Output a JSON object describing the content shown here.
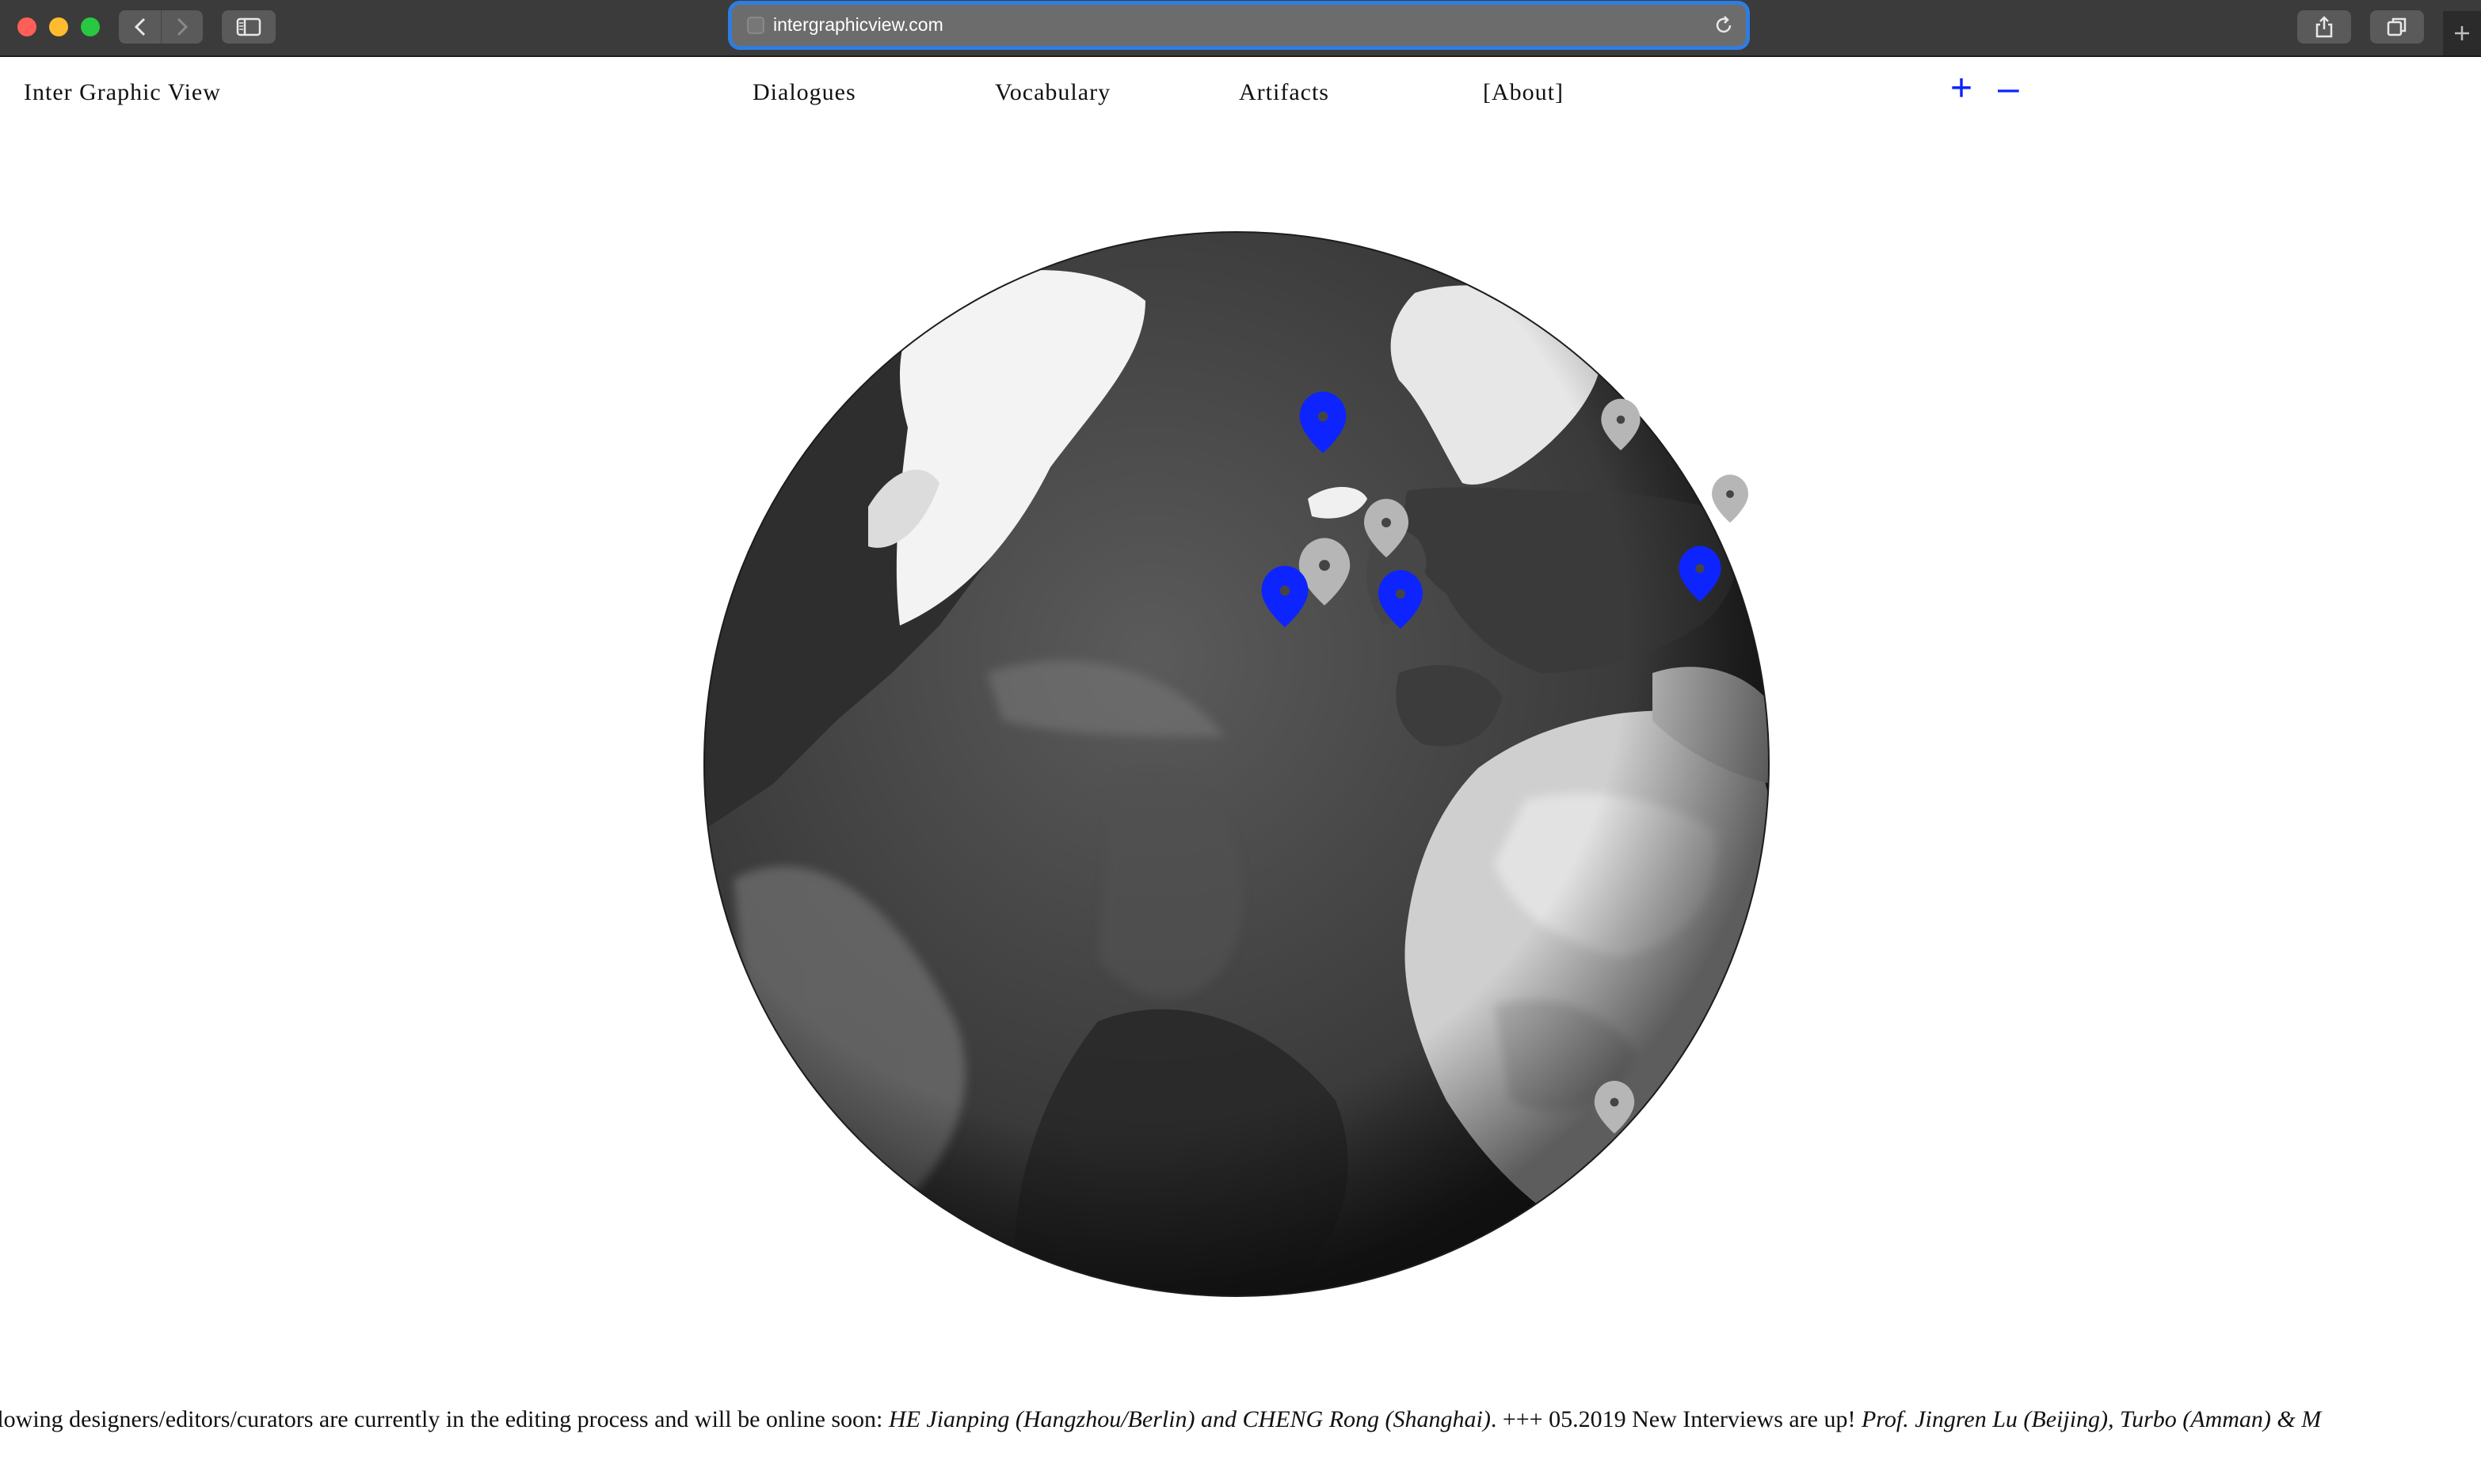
{
  "browser": {
    "url": "intergraphicview.com"
  },
  "site": {
    "title": "Inter Graphic View",
    "nav": [
      {
        "label": "Dialogues"
      },
      {
        "label": "Vocabulary"
      },
      {
        "label": "Artifacts"
      },
      {
        "label": "[About]"
      }
    ],
    "zoom_in_label": "+",
    "zoom_out_label": "–"
  },
  "globe": {
    "markers": [
      {
        "status": "active"
      },
      {
        "status": "inactive"
      },
      {
        "status": "inactive"
      },
      {
        "status": "inactive"
      },
      {
        "status": "inactive"
      },
      {
        "status": "active"
      },
      {
        "status": "active"
      },
      {
        "status": "active"
      },
      {
        "status": "inactive"
      }
    ],
    "colors": {
      "active": "#0d24ff",
      "inactive": "#b6b6b6"
    }
  },
  "ticker": {
    "part1": "llowing designers/editors/curators are currently in the editing process and will be online soon: ",
    "part2": "HE Jianping (Hangzhou/Berlin) and CHENG Rong (Shanghai)",
    "part3": ".   +++ 05.2019 New Interviews are up! ",
    "part4": "Prof. Jingren Lu (Beijing), Turbo (Amman) & M"
  },
  "colors": {
    "accent": "#0d24ff",
    "chrome": "#3b3b3b",
    "url_focus": "#2f7de1"
  }
}
